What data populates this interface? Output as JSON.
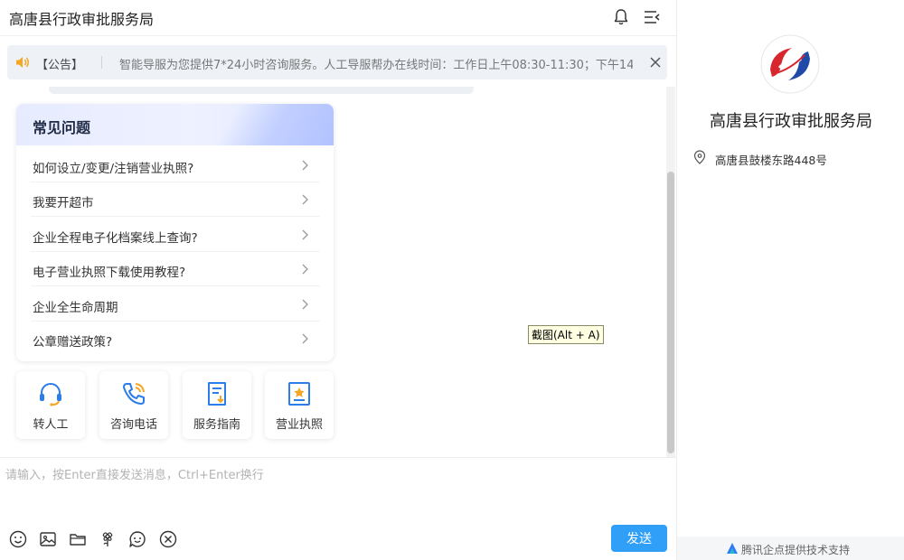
{
  "header": {
    "title": "高唐县行政审批服务局",
    "icons": [
      "bell-icon",
      "menu-collapse-icon"
    ]
  },
  "notice": {
    "tag": "【公告】",
    "text": "智能导服为您提供7*24小时咨询服务。人工导服帮办在线时间：工作日上午08:30-11:30；下午14",
    "icons": [
      "speaker-icon",
      "close-icon"
    ]
  },
  "faq": {
    "title": "常见问题",
    "items": [
      {
        "label": "如何设立/变更/注销营业执照?"
      },
      {
        "label": "我要开超市"
      },
      {
        "label": "企业全程电子化档案线上查询?"
      },
      {
        "label": "电子营业执照下载使用教程?"
      },
      {
        "label": "企业全生命周期"
      },
      {
        "label": "公章赠送政策?"
      }
    ]
  },
  "quick_actions": [
    {
      "label": "转人工",
      "icon": "headset-icon"
    },
    {
      "label": "咨询电话",
      "icon": "phone-icon"
    },
    {
      "label": "服务指南",
      "icon": "guide-icon"
    },
    {
      "label": "营业执照",
      "icon": "license-icon"
    }
  ],
  "tooltip": "截图(Alt + A)",
  "input": {
    "placeholder": "请输入，按Enter直接发送消息，Ctrl+Enter换行",
    "value": "",
    "tools": [
      "emoji-icon",
      "image-icon",
      "folder-icon",
      "flower-icon",
      "chat-bubble-icon",
      "close-circle-icon"
    ],
    "send_label": "发送"
  },
  "sidebar": {
    "org_name": "高唐县行政审批服务局",
    "address": "高唐县鼓楼东路448号",
    "footer": "腾讯企点提供技术支持"
  },
  "colors": {
    "accent": "#2f9ff8",
    "icon_blue": "#2b7de9",
    "icon_orange": "#f5a623",
    "logo_red": "#d8262e",
    "logo_blue": "#1f4aa8"
  }
}
